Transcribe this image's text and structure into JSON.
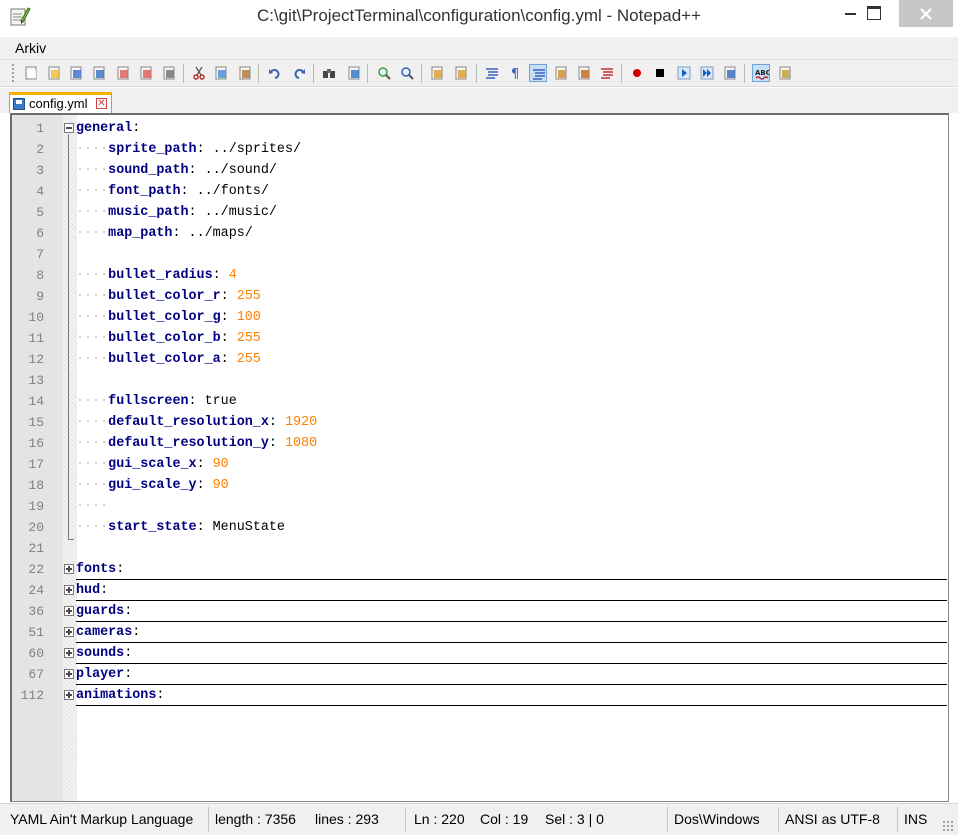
{
  "window": {
    "title": "C:\\git\\ProjectTerminal\\configuration\\config.yml - Notepad++",
    "close_glyph": "✕"
  },
  "menu": {
    "items": [
      {
        "label": "Arkiv"
      }
    ]
  },
  "toolbar": {
    "icons": [
      "new-file-icon",
      "open-file-icon",
      "save-icon",
      "save-all-icon",
      "close-icon",
      "close-all-icon",
      "print-icon",
      "cut-icon",
      "copy-icon",
      "paste-icon",
      "undo-icon",
      "redo-icon",
      "find-icon",
      "replace-icon",
      "zoom-in-icon",
      "zoom-out-icon",
      "sync-vertical-icon",
      "sync-horizontal-icon",
      "word-wrap-icon",
      "show-all-chars-icon",
      "indent-guide-icon",
      "user-lang-icon",
      "doc-map-icon",
      "function-list-icon",
      "record-macro-icon",
      "stop-macro-icon",
      "play-macro-icon",
      "run-macro-multiple-icon",
      "save-macro-icon",
      "spell-check-icon",
      "spell-options-icon"
    ]
  },
  "tab": {
    "label": "config.yml",
    "close_glyph": "✕"
  },
  "editor": {
    "lines": [
      {
        "num": "1",
        "fold": "minus",
        "indent": "",
        "key": "general",
        "sep": ":",
        "value": "",
        "value_type": ""
      },
      {
        "num": "2",
        "fold": "",
        "indent": "····",
        "key": "sprite_path",
        "sep": ":",
        "value": " ../sprites/",
        "value_type": "str"
      },
      {
        "num": "3",
        "fold": "",
        "indent": "····",
        "key": "sound_path",
        "sep": ":",
        "value": " ../sound/",
        "value_type": "str"
      },
      {
        "num": "4",
        "fold": "",
        "indent": "····",
        "key": "font_path",
        "sep": ":",
        "value": " ../fonts/",
        "value_type": "str"
      },
      {
        "num": "5",
        "fold": "",
        "indent": "····",
        "key": "music_path",
        "sep": ":",
        "value": " ../music/",
        "value_type": "str"
      },
      {
        "num": "6",
        "fold": "",
        "indent": "····",
        "key": "map_path",
        "sep": ":",
        "value": " ../maps/",
        "value_type": "str"
      },
      {
        "num": "7",
        "fold": "",
        "indent": "",
        "key": "",
        "sep": "",
        "value": "",
        "value_type": ""
      },
      {
        "num": "8",
        "fold": "",
        "indent": "····",
        "key": "bullet_radius",
        "sep": ":",
        "value": " 4",
        "value_type": "num"
      },
      {
        "num": "9",
        "fold": "",
        "indent": "····",
        "key": "bullet_color_r",
        "sep": ":",
        "value": " 255",
        "value_type": "num"
      },
      {
        "num": "10",
        "fold": "",
        "indent": "····",
        "key": "bullet_color_g",
        "sep": ":",
        "value": " 100",
        "value_type": "num"
      },
      {
        "num": "11",
        "fold": "",
        "indent": "····",
        "key": "bullet_color_b",
        "sep": ":",
        "value": " 255",
        "value_type": "num"
      },
      {
        "num": "12",
        "fold": "",
        "indent": "····",
        "key": "bullet_color_a",
        "sep": ":",
        "value": " 255",
        "value_type": "num"
      },
      {
        "num": "13",
        "fold": "",
        "indent": "",
        "key": "",
        "sep": "",
        "value": "",
        "value_type": ""
      },
      {
        "num": "14",
        "fold": "",
        "indent": "····",
        "key": "fullscreen",
        "sep": ":",
        "value": " true",
        "value_type": "str"
      },
      {
        "num": "15",
        "fold": "",
        "indent": "····",
        "key": "default_resolution_x",
        "sep": ":",
        "value": " 1920",
        "value_type": "num"
      },
      {
        "num": "16",
        "fold": "",
        "indent": "····",
        "key": "default_resolution_y",
        "sep": ":",
        "value": " 1080",
        "value_type": "num"
      },
      {
        "num": "17",
        "fold": "",
        "indent": "····",
        "key": "gui_scale_x",
        "sep": ":",
        "value": " 90",
        "value_type": "num"
      },
      {
        "num": "18",
        "fold": "",
        "indent": "····",
        "key": "gui_scale_y",
        "sep": ":",
        "value": " 90",
        "value_type": "num"
      },
      {
        "num": "19",
        "fold": "",
        "indent": "····",
        "key": "",
        "sep": "",
        "value": "",
        "value_type": ""
      },
      {
        "num": "20",
        "fold": "",
        "indent": "····",
        "key": "start_state",
        "sep": ":",
        "value": " MenuState",
        "value_type": "str"
      },
      {
        "num": "21",
        "fold": "",
        "indent": "",
        "key": "",
        "sep": "",
        "value": "",
        "value_type": ""
      },
      {
        "num": "22",
        "fold": "plus",
        "indent": "",
        "key": "fonts",
        "sep": ":",
        "value": "",
        "value_type": ""
      },
      {
        "num": "24",
        "fold": "plus",
        "indent": "",
        "key": "hud",
        "sep": ":",
        "value": "",
        "value_type": ""
      },
      {
        "num": "36",
        "fold": "plus",
        "indent": "",
        "key": "guards",
        "sep": ":",
        "value": "",
        "value_type": ""
      },
      {
        "num": "51",
        "fold": "plus",
        "indent": "",
        "key": "cameras",
        "sep": ":",
        "value": "",
        "value_type": ""
      },
      {
        "num": "60",
        "fold": "plus",
        "indent": "",
        "key": "sounds",
        "sep": ":",
        "value": "",
        "value_type": ""
      },
      {
        "num": "67",
        "fold": "plus",
        "indent": "",
        "key": "player",
        "sep": ":",
        "value": "",
        "value_type": ""
      },
      {
        "num": "112",
        "fold": "plus",
        "indent": "",
        "key": "animations",
        "sep": ":",
        "value": "",
        "value_type": ""
      }
    ]
  },
  "statusbar": {
    "language": "YAML Ain't Markup Language",
    "length": "length : 7356",
    "lines": "lines : 293",
    "ln": "Ln : 220",
    "col": "Col : 19",
    "sel": "Sel : 3 | 0",
    "eol": "Dos\\Windows",
    "encoding": "ANSI as UTF-8",
    "mode": "INS"
  },
  "colors": {
    "key": "#000080",
    "number": "#ff8000",
    "tab_accent": "#fab005"
  }
}
